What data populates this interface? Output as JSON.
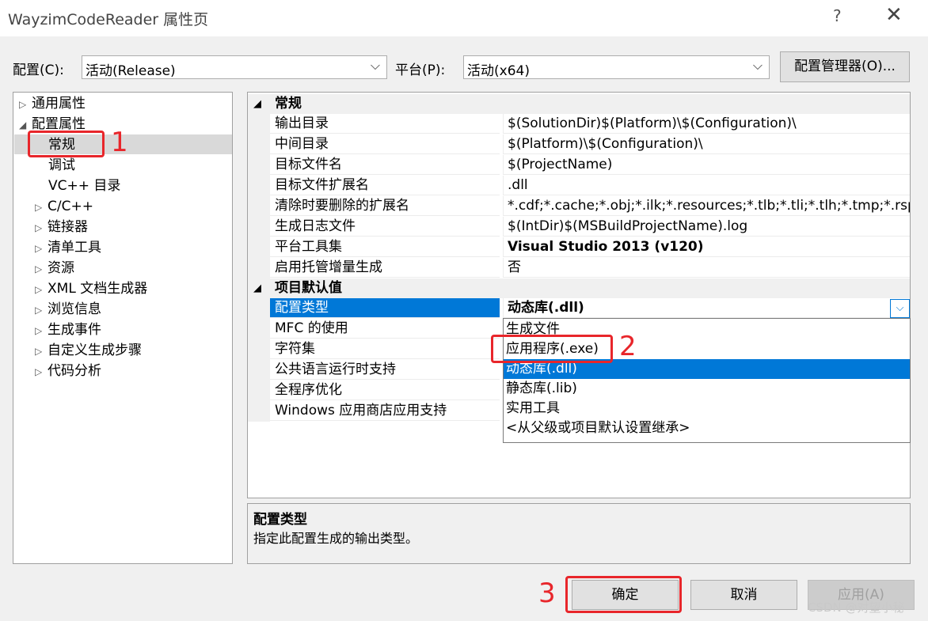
{
  "window": {
    "title": "WayzimCodeReader 属性页",
    "help_glyph": "?",
    "close_glyph": "✕"
  },
  "top": {
    "config_label": "配置(C):",
    "config_value": "活动(Release)",
    "platform_label": "平台(P):",
    "platform_value": "活动(x64)",
    "config_manager_button": "配置管理器(O)..."
  },
  "tree": {
    "items": [
      {
        "label": "通用属性",
        "expander": "▷"
      },
      {
        "label": "配置属性",
        "expander": "◢"
      },
      {
        "label": "常规",
        "expander": ""
      },
      {
        "label": "调试",
        "expander": ""
      },
      {
        "label": "VC++ 目录",
        "expander": ""
      },
      {
        "label": "C/C++",
        "expander": "▷"
      },
      {
        "label": "链接器",
        "expander": "▷"
      },
      {
        "label": "清单工具",
        "expander": "▷"
      },
      {
        "label": "资源",
        "expander": "▷"
      },
      {
        "label": "XML 文档生成器",
        "expander": "▷"
      },
      {
        "label": "浏览信息",
        "expander": "▷"
      },
      {
        "label": "生成事件",
        "expander": "▷"
      },
      {
        "label": "自定义生成步骤",
        "expander": "▷"
      },
      {
        "label": "代码分析",
        "expander": "▷"
      }
    ],
    "selected": "常规"
  },
  "grid": {
    "section1": {
      "title": "常规",
      "collapse_glyph": "◢"
    },
    "general_rows": [
      {
        "name": "输出目录",
        "value": "$(SolutionDir)$(Platform)\\$(Configuration)\\"
      },
      {
        "name": "中间目录",
        "value": "$(Platform)\\$(Configuration)\\"
      },
      {
        "name": "目标文件名",
        "value": "$(ProjectName)"
      },
      {
        "name": "目标文件扩展名",
        "value": ".dll"
      },
      {
        "name": "清除时要删除的扩展名",
        "value": "*.cdf;*.cache;*.obj;*.ilk;*.resources;*.tlb;*.tli;*.tlh;*.tmp;*.rsp;*.p"
      },
      {
        "name": "生成日志文件",
        "value": "$(IntDir)$(MSBuildProjectName).log"
      },
      {
        "name": "平台工具集",
        "value": "Visual Studio 2013 (v120)"
      },
      {
        "name": "启用托管增量生成",
        "value": "否"
      }
    ],
    "section2": {
      "title": "项目默认值",
      "collapse_glyph": "◢"
    },
    "default_rows": [
      {
        "name": "配置类型",
        "value": "动态库(.dll)"
      },
      {
        "name": "MFC 的使用",
        "value": ""
      },
      {
        "name": "字符集",
        "value": ""
      },
      {
        "name": "公共语言运行时支持",
        "value": ""
      },
      {
        "name": "全程序优化",
        "value": ""
      },
      {
        "name": "Windows 应用商店应用支持",
        "value": ""
      }
    ],
    "dropdown_arrow": "⌵",
    "dropdown_options": [
      "生成文件",
      "应用程序(.exe)",
      "动态库(.dll)",
      "静态库(.lib)",
      "实用工具",
      "<从父级或项目默认设置继承>"
    ],
    "highlighted_option": "动态库(.dll)"
  },
  "description": {
    "title": "配置类型",
    "text": "指定此配置生成的输出类型。"
  },
  "buttons": {
    "ok": "确定",
    "cancel": "取消",
    "apply": "应用(A)"
  },
  "annotations": {
    "n1": "1",
    "n2": "2",
    "n3": "3",
    "accent": "#e8262b"
  },
  "watermark": "CSDN @对望小秘"
}
